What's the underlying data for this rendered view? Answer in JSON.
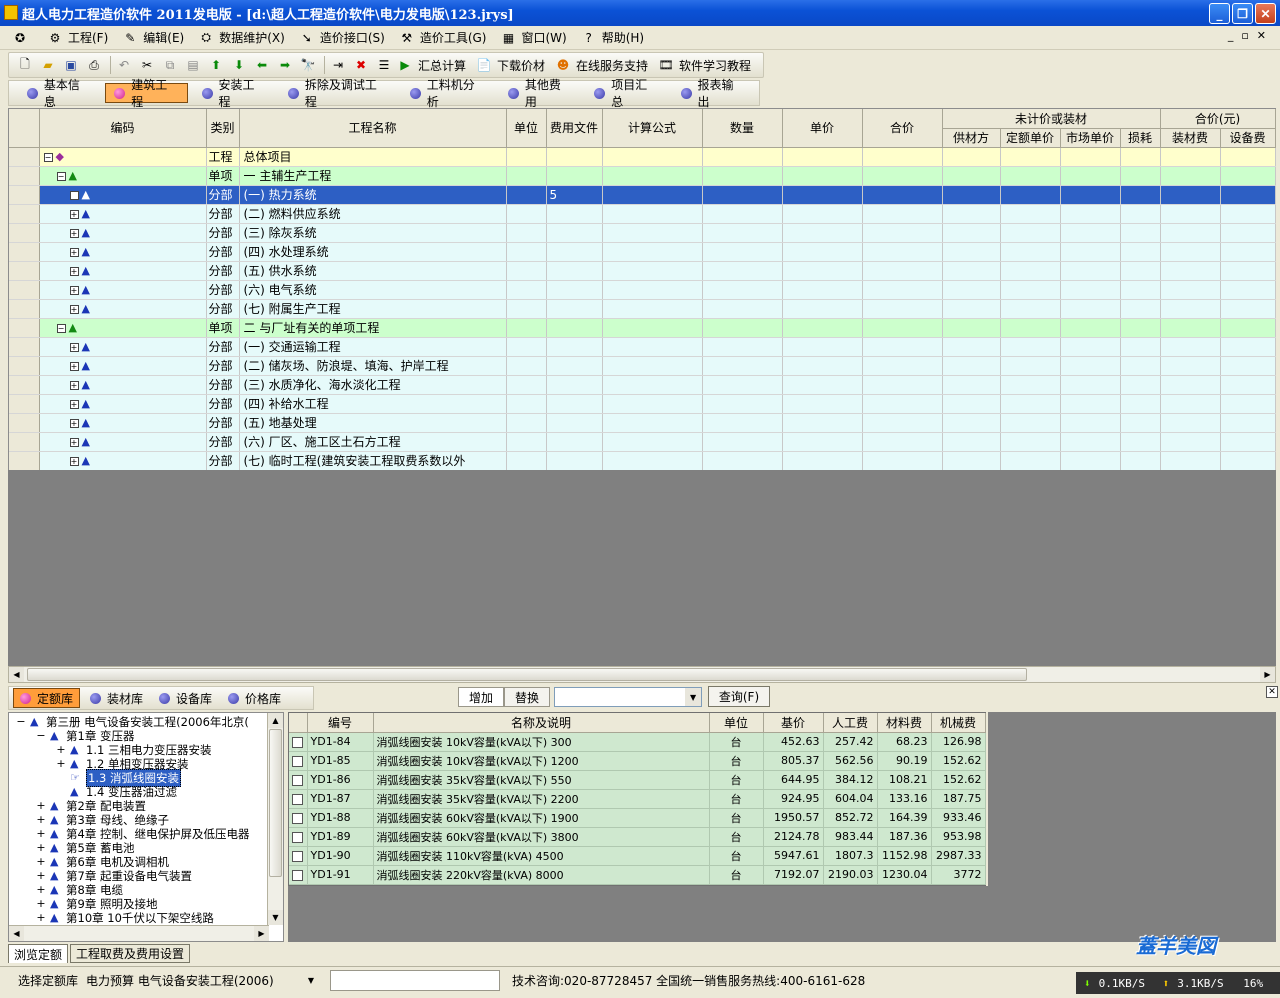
{
  "window": {
    "title": "超人电力工程造价软件 2011发电版 - [d:\\超人工程造价软件\\电力发电版\\123.jrys]"
  },
  "menu": [
    {
      "icon": "app-logo-icon",
      "label": ""
    },
    {
      "icon": "project-icon",
      "label": "工程(F)"
    },
    {
      "icon": "edit-icon",
      "label": "编辑(E)"
    },
    {
      "icon": "data-icon",
      "label": "数据维护(X)"
    },
    {
      "icon": "interface-icon",
      "label": "造价接口(S)"
    },
    {
      "icon": "tools-icon",
      "label": "造价工具(G)"
    },
    {
      "icon": "window-icon",
      "label": "窗口(W)"
    },
    {
      "icon": "help-icon",
      "label": "帮助(H)"
    }
  ],
  "toolbar": {
    "summary_label": "汇总计算",
    "download_label": "下载价材",
    "online_label": "在线服务支持",
    "tutorial_label": "软件学习教程"
  },
  "tabs": [
    {
      "label": "基本信息",
      "active": false
    },
    {
      "label": "建筑工程",
      "active": true
    },
    {
      "label": "安装工程",
      "active": false
    },
    {
      "label": "拆除及调试工程",
      "active": false
    },
    {
      "label": "工料机分析",
      "active": false
    },
    {
      "label": "其他费用",
      "active": false
    },
    {
      "label": "项目汇总",
      "active": false
    },
    {
      "label": "报表输出",
      "active": false
    }
  ],
  "main_grid": {
    "headers": {
      "code": "编码",
      "type": "类别",
      "name": "工程名称",
      "unit": "单位",
      "fee_file": "费用文件",
      "formula": "计算公式",
      "qty": "数量",
      "price": "单价",
      "total": "合价",
      "unpriced_group": "未计价或装材",
      "supplier": "供材方",
      "quota_price": "定额单价",
      "market_price": "市场单价",
      "loss": "损耗",
      "total_group": "合价(元)",
      "material_fee": "装材费",
      "equipment_fee": "设备费"
    },
    "rows": [
      {
        "kind": "proj",
        "level": 0,
        "type": "工程",
        "name": "总体项目",
        "fee": ""
      },
      {
        "kind": "unit",
        "level": 1,
        "type": "单项",
        "name": "一 主辅生产工程",
        "fee": ""
      },
      {
        "kind": "sel",
        "level": 2,
        "type": "分部",
        "name": "(一) 热力系统",
        "fee": "5"
      },
      {
        "kind": "part",
        "level": 2,
        "type": "分部",
        "name": "(二) 燃料供应系统",
        "fee": ""
      },
      {
        "kind": "part",
        "level": 2,
        "type": "分部",
        "name": "(三) 除灰系统",
        "fee": ""
      },
      {
        "kind": "part",
        "level": 2,
        "type": "分部",
        "name": "(四) 水处理系统",
        "fee": ""
      },
      {
        "kind": "part",
        "level": 2,
        "type": "分部",
        "name": "(五) 供水系统",
        "fee": ""
      },
      {
        "kind": "part",
        "level": 2,
        "type": "分部",
        "name": "(六) 电气系统",
        "fee": ""
      },
      {
        "kind": "part",
        "level": 2,
        "type": "分部",
        "name": "(七) 附属生产工程",
        "fee": ""
      },
      {
        "kind": "unit",
        "level": 1,
        "type": "单项",
        "name": "二 与厂址有关的单项工程",
        "fee": ""
      },
      {
        "kind": "part",
        "level": 2,
        "type": "分部",
        "name": "(一) 交通运输工程",
        "fee": ""
      },
      {
        "kind": "part",
        "level": 2,
        "type": "分部",
        "name": "(二) 储灰场、防浪堤、填海、护岸工程",
        "fee": ""
      },
      {
        "kind": "part",
        "level": 2,
        "type": "分部",
        "name": "(三) 水质净化、海水淡化工程",
        "fee": ""
      },
      {
        "kind": "part",
        "level": 2,
        "type": "分部",
        "name": "(四) 补给水工程",
        "fee": ""
      },
      {
        "kind": "part",
        "level": 2,
        "type": "分部",
        "name": "(五) 地基处理",
        "fee": ""
      },
      {
        "kind": "part",
        "level": 2,
        "type": "分部",
        "name": "(六) 厂区、施工区土石方工程",
        "fee": ""
      },
      {
        "kind": "part",
        "level": 2,
        "type": "分部",
        "name": "(七) 临时工程(建筑安装工程取费系数以外",
        "fee": ""
      }
    ]
  },
  "library": {
    "tabs": [
      {
        "label": "定额库",
        "active": true
      },
      {
        "label": "装材库",
        "active": false
      },
      {
        "label": "设备库",
        "active": false
      },
      {
        "label": "价格库",
        "active": false
      }
    ],
    "add_label": "增加",
    "replace_label": "替换",
    "query_label": "查询(F)"
  },
  "lib_tree": [
    {
      "label": "第三册 电气设备安装工程(2006年北京(",
      "depth": 0,
      "exp": "−",
      "sel": false
    },
    {
      "label": "第1章 变压器",
      "depth": 1,
      "exp": "−",
      "sel": false
    },
    {
      "label": "1.1 三相电力变压器安装",
      "depth": 2,
      "exp": "+",
      "sel": false
    },
    {
      "label": "1.2 单相变压器安装",
      "depth": 2,
      "exp": "+",
      "sel": false
    },
    {
      "label": "1.3 消弧线圈安装",
      "depth": 2,
      "exp": "",
      "sel": true
    },
    {
      "label": "1.4 变压器油过滤",
      "depth": 2,
      "exp": "",
      "sel": false
    },
    {
      "label": "第2章 配电装置",
      "depth": 1,
      "exp": "+",
      "sel": false
    },
    {
      "label": "第3章 母线、绝缘子",
      "depth": 1,
      "exp": "+",
      "sel": false
    },
    {
      "label": "第4章 控制、继电保护屏及低压电器",
      "depth": 1,
      "exp": "+",
      "sel": false
    },
    {
      "label": "第5章 蓄电池",
      "depth": 1,
      "exp": "+",
      "sel": false
    },
    {
      "label": "第6章 电机及调相机",
      "depth": 1,
      "exp": "+",
      "sel": false
    },
    {
      "label": "第7章 起重设备电气装置",
      "depth": 1,
      "exp": "+",
      "sel": false
    },
    {
      "label": "第8章 电缆",
      "depth": 1,
      "exp": "+",
      "sel": false
    },
    {
      "label": "第9章 照明及接地",
      "depth": 1,
      "exp": "+",
      "sel": false
    },
    {
      "label": "第10章 10千伏以下架空线路",
      "depth": 1,
      "exp": "+",
      "sel": false
    }
  ],
  "quota_table": {
    "headers": [
      "编号",
      "名称及说明",
      "单位",
      "基价",
      "人工费",
      "材料费",
      "机械费"
    ],
    "rows": [
      [
        "YD1-84",
        "消弧线圈安装 10kV容量(kVA以下) 300",
        "台",
        "452.63",
        "257.42",
        "68.23",
        "126.98"
      ],
      [
        "YD1-85",
        "消弧线圈安装 10kV容量(kVA以下) 1200",
        "台",
        "805.37",
        "562.56",
        "90.19",
        "152.62"
      ],
      [
        "YD1-86",
        "消弧线圈安装 35kV容量(kVA以下) 550",
        "台",
        "644.95",
        "384.12",
        "108.21",
        "152.62"
      ],
      [
        "YD1-87",
        "消弧线圈安装 35kV容量(kVA以下) 2200",
        "台",
        "924.95",
        "604.04",
        "133.16",
        "187.75"
      ],
      [
        "YD1-88",
        "消弧线圈安装 60kV容量(kVA以下) 1900",
        "台",
        "1950.57",
        "852.72",
        "164.39",
        "933.46"
      ],
      [
        "YD1-89",
        "消弧线圈安装 60kV容量(kVA以下) 3800",
        "台",
        "2124.78",
        "983.44",
        "187.36",
        "953.98"
      ],
      [
        "YD1-90",
        "消弧线圈安装 110kV容量(kVA) 4500",
        "台",
        "5947.61",
        "1807.3",
        "1152.98",
        "2987.33"
      ],
      [
        "YD1-91",
        "消弧线圈安装 220kV容量(kVA) 8000",
        "台",
        "7192.07",
        "2190.03",
        "1230.04",
        "3772"
      ]
    ]
  },
  "bottom_tabs": [
    "浏览定额",
    "工程取费及费用设置"
  ],
  "status": {
    "select_lib": "选择定额库",
    "lib_name": "电力预算 电气设备安装工程(2006)",
    "consult": "技术咨询:020-87728457 全国统一销售服务热线:400-6161-628",
    "down": "0.1KB/S",
    "up": "3.1KB/S",
    "pct": "16%"
  }
}
